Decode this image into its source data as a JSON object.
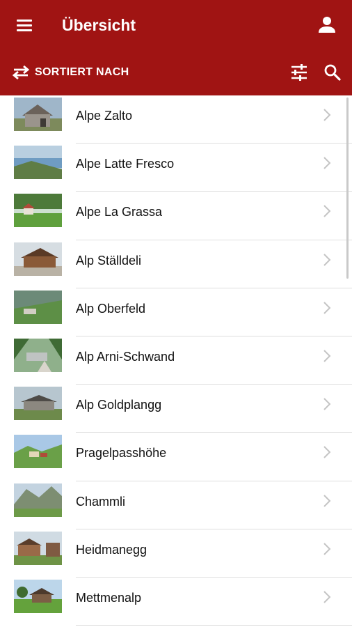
{
  "header": {
    "title": "Übersicht",
    "sort_label": "SORTIERT NACH",
    "colors": {
      "bar": "#a01413",
      "text": "#ffffff"
    },
    "icons": [
      "menu-icon",
      "account-icon",
      "swap-icon",
      "tune-icon",
      "search-icon"
    ]
  },
  "list": {
    "items": [
      {
        "name": "Alpe Zalto"
      },
      {
        "name": "Alpe Latte Fresco"
      },
      {
        "name": "Alpe La Grassa"
      },
      {
        "name": "Alp Ställdeli"
      },
      {
        "name": "Alp Oberfeld"
      },
      {
        "name": "Alp Arni-Schwand"
      },
      {
        "name": "Alp Goldplangg"
      },
      {
        "name": "Pragelpasshöhe"
      },
      {
        "name": "Chammli"
      },
      {
        "name": "Heidmanegg"
      },
      {
        "name": "Mettmenalp"
      }
    ],
    "chevron_icon": "chevron-right-icon"
  }
}
